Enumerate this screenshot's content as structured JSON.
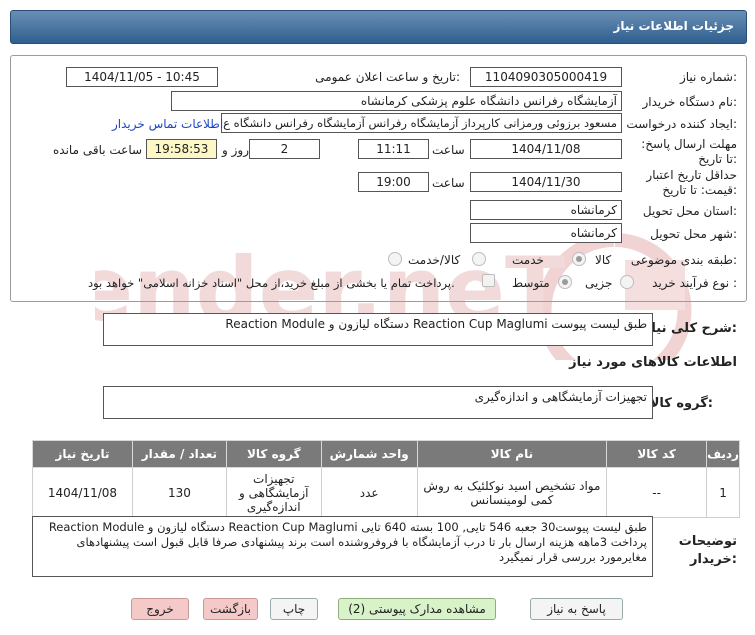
{
  "header": {
    "title": "جزئیات اطلاعات نیاز"
  },
  "form": {
    "need_number_label": "شماره نیاز:",
    "need_number": "1104090305000419",
    "announce_label": "تاریخ و ساعت اعلان عمومی:",
    "announce_value": "1404/11/05 - 10:45",
    "buyer_label": "نام دستگاه خریدار:",
    "buyer_value": "آزمایشگاه رفرانس دانشگاه علوم پزشکی کرمانشاه",
    "creator_label": "ایجاد کننده درخواست:",
    "creator_value": "مسعود برزوئی ورمزانی کارپرداز آزمایشگاه رفرانس آزمایشگاه رفرانس دانشگاه ع",
    "contact_link": "اطلاعات تماس خریدار",
    "deadline_label": "مهلت ارسال پاسخ: تا تاریخ:",
    "deadline_date": "1404/11/08",
    "time_label": "ساعت",
    "deadline_time": "11:11",
    "days_value": "2",
    "days_label": "روز و",
    "remaining_time": "19:58:53",
    "remaining_label": "ساعت باقی مانده",
    "validity_label": "حداقل تاریخ اعتبار قیمت: تا تاریخ:",
    "validity_date": "1404/11/30",
    "validity_time": "19:00",
    "province_label": "استان محل تحویل:",
    "province_value": "کرمانشاه",
    "city_label": "شهر محل تحویل:",
    "city_value": "کرمانشاه",
    "category_label": "طبقه بندی موضوعی:",
    "category_options": [
      "کالا",
      "خدمت",
      "کالا/خدمت"
    ],
    "process_label": "نوع فرآیند خرید :",
    "process_options": [
      "جزیی",
      "متوسط"
    ],
    "payment_note": "پرداخت تمام یا بخشی از مبلغ خرید،از محل \"اسناد خزانه اسلامی\" خواهد بود."
  },
  "general": {
    "label": "شرح کلی نیاز:",
    "value": "Reaction Module دستگاه لیازون و Reaction Cup Maglumi طبق لیست پیوست"
  },
  "goods_info_title": "اطلاعات کالاهای مورد نیاز",
  "goods_group": {
    "label": "گروه کالا:",
    "value": "تجهیزات آزمایشگاهی و اندازه‌گیری"
  },
  "table": {
    "headers": [
      "ردیف",
      "کد کالا",
      "نام کالا",
      "واحد شمارش",
      "گروه کالا",
      "تعداد / مقدار",
      "تاریخ نیاز"
    ],
    "rows": [
      [
        "1",
        "--",
        "مواد تشخیص اسید نوکلئیک به روش کمی لومینسانس",
        "عدد",
        "تجهیزات آزمایشگاهی و اندازه‌گیری",
        "130",
        "1404/11/08"
      ]
    ]
  },
  "buyer_notes": {
    "label": "توضیحات خریدار:",
    "value": "Reaction Module دستگاه لیازون و Reaction Cup Maglumi طبق لیست پیوست30 جعبه 546 تایی, 100 بسته 640 تایی پرداخت 3ماهه هزینه ارسال بار تا درب آزمایشگاه با فروفروشنده است برند پیشنهادی صرفا قابل قبول است پیشنهادهای مغایرمورد بررسی قرار نمیگیرد"
  },
  "buttons": {
    "reply": "پاسخ به نیاز",
    "attachments": "مشاهده مدارک پیوستی (2)",
    "print": "چاپ",
    "back": "بازگشت",
    "exit": "خروج"
  },
  "watermark": {
    "text": "AriaTender.neT"
  },
  "colors": {
    "header": "#3f6c99",
    "table_header": "#7a7a7a",
    "remaining_bg": "#fdf7c6",
    "link": "#1b47c5"
  }
}
